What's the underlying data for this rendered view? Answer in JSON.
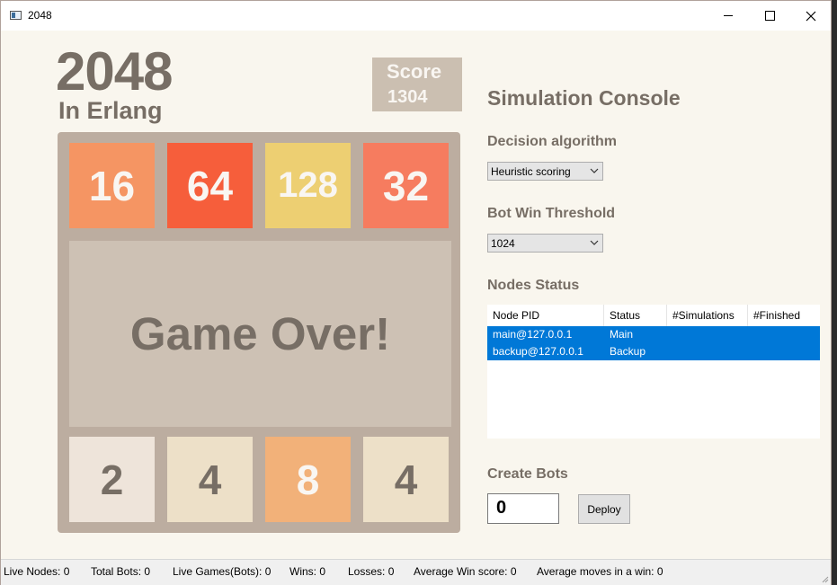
{
  "window": {
    "title": "2048",
    "controls": {
      "minimize": "minimize-icon",
      "maximize": "maximize-icon",
      "close": "close-icon"
    }
  },
  "game": {
    "title": "2048",
    "subtitle": "In Erlang",
    "score_label": "Score",
    "score_value": "1304",
    "overlay_text": "Game Over!",
    "top_row": [
      {
        "value": "16",
        "bg": "#f59563",
        "color": "#f9f6f2"
      },
      {
        "value": "64",
        "bg": "#f65e3b",
        "color": "#f9f6f2"
      },
      {
        "value": "128",
        "bg": "#edcf72",
        "color": "#f9f6f2"
      },
      {
        "value": "32",
        "bg": "#f67c5f",
        "color": "#f9f6f2"
      }
    ],
    "bottom_row": [
      {
        "value": "2",
        "bg": "#eee4da",
        "color": "#776e65"
      },
      {
        "value": "4",
        "bg": "#ede0c8",
        "color": "#776e65"
      },
      {
        "value": "8",
        "bg": "#f2b179",
        "color": "#f9f6f2"
      },
      {
        "value": "4",
        "bg": "#ede0c8",
        "color": "#776e65"
      }
    ]
  },
  "console": {
    "title": "Simulation Console",
    "decision_label": "Decision algorithm",
    "decision_value": "Heuristic scoring",
    "threshold_label": "Bot Win Threshold",
    "threshold_value": "1024",
    "nodes_label": "Nodes Status",
    "nodes_columns": [
      "Node PID",
      "Status",
      "#Simulations",
      "#Finished"
    ],
    "nodes_rows": [
      {
        "pid": "main@127.0.0.1",
        "status": "Main",
        "simulations": "",
        "finished": ""
      },
      {
        "pid": "backup@127.0.0.1",
        "status": "Backup",
        "simulations": "",
        "finished": ""
      }
    ],
    "create_label": "Create Bots",
    "bots_value": "0",
    "deploy_label": "Deploy"
  },
  "statusbar": [
    "Live Nodes:  0",
    "Total Bots:  0",
    "Live Games(Bots):  0",
    "Wins:  0",
    "Losses:  0",
    "Average Win score:  0",
    "Average moves in a win:  0"
  ],
  "colors": {
    "accent_selection": "#0078d7",
    "text_brown": "#776e65",
    "board_bg": "#bcada0"
  }
}
